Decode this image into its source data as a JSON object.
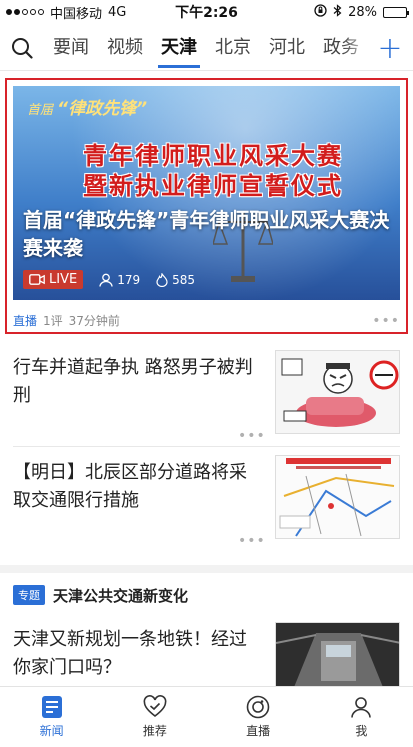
{
  "status_bar": {
    "carrier": "中国移动",
    "network": "4G",
    "time": "下午2:26",
    "battery": "28%",
    "battery_level": 0.28
  },
  "tabs": [
    {
      "label": "要闻",
      "active": false
    },
    {
      "label": "视频",
      "active": false
    },
    {
      "label": "天津",
      "active": true
    },
    {
      "label": "北京",
      "active": false
    },
    {
      "label": "河北",
      "active": false
    },
    {
      "label": "政务",
      "active": false
    }
  ],
  "tab_add_label": "+",
  "featured": {
    "hero_topline_prefix": "首届",
    "hero_topline_main": "“律政先锋”",
    "hero_banner_line1": "青年律师职业风采大赛",
    "hero_banner_line2": "暨新执业律师宣誓仪式",
    "title": "首届“律政先锋”青年律师职业风采大赛决赛来袭",
    "live_label": "LIVE",
    "viewers": "179",
    "hot": "585",
    "tag": "直播",
    "comments": "1评",
    "time": "37分钟前"
  },
  "news": [
    {
      "title": "行车并道起争执 路怒男子被判刑",
      "thumb": "road-rage-cartoon"
    },
    {
      "title": "【明日】北辰区部分道路将采取交通限行措施",
      "thumb": "traffic-map"
    }
  ],
  "topic": {
    "badge": "专题",
    "title": "天津公共交通新变化"
  },
  "topic_article": {
    "title": "天津又新规划一条地铁！经过你家门口吗？",
    "thumb": "subway-tunnel"
  },
  "bottom_nav": [
    {
      "label": "新闻",
      "icon": "news-icon",
      "active": true
    },
    {
      "label": "推荐",
      "icon": "recommend-icon",
      "active": false
    },
    {
      "label": "直播",
      "icon": "live-icon",
      "active": false
    },
    {
      "label": "我",
      "icon": "profile-icon",
      "active": false
    }
  ],
  "colors": {
    "accent": "#2b6fd6",
    "highlight_border": "#d8232a",
    "live_badge": "#c93a2e"
  }
}
